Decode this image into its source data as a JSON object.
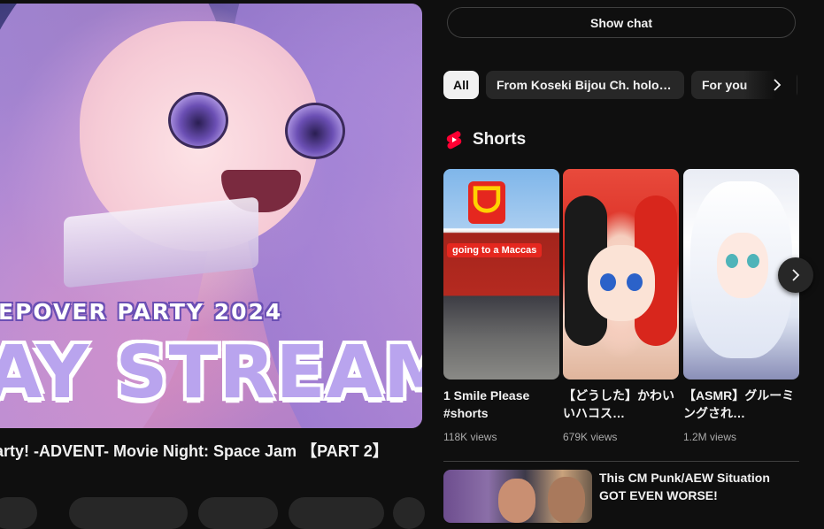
{
  "player": {
    "banner_sub": "EPOVER PARTY 2024",
    "banner_main": "AY STREAM"
  },
  "video": {
    "title": "arty! -ADVENT- Movie Night: Space Jam 【PART 2】"
  },
  "chat": {
    "show_chat_label": "Show chat"
  },
  "chips": [
    {
      "label": "All",
      "active": true
    },
    {
      "label": "From Koseki Bijou Ch. hololive-EN",
      "active": false
    },
    {
      "label": "For you",
      "active": false
    }
  ],
  "shorts": {
    "heading": "Shorts",
    "items": [
      {
        "title": "1 Smile Please #shorts",
        "views": "118K views",
        "overlay_text": "going to a Maccas",
        "sign_text": "ᗜ"
      },
      {
        "title": "【どうした】かわいいハコス…",
        "views": "679K views"
      },
      {
        "title": "【ASMR】グルーミングされ…",
        "views": "1.2M views"
      }
    ]
  },
  "recommendation": {
    "title": "This CM Punk/AEW Situation GOT EVEN WORSE!"
  },
  "colors": {
    "background": "#0f0f0f",
    "chip_bg": "#272727",
    "shorts_red": "#ff0033",
    "text_secondary": "#aaaaaa"
  },
  "icons": {
    "chips_next": "chevron-right-icon",
    "shorts_logo": "youtube-shorts-icon",
    "shorts_next": "chevron-right-icon"
  }
}
